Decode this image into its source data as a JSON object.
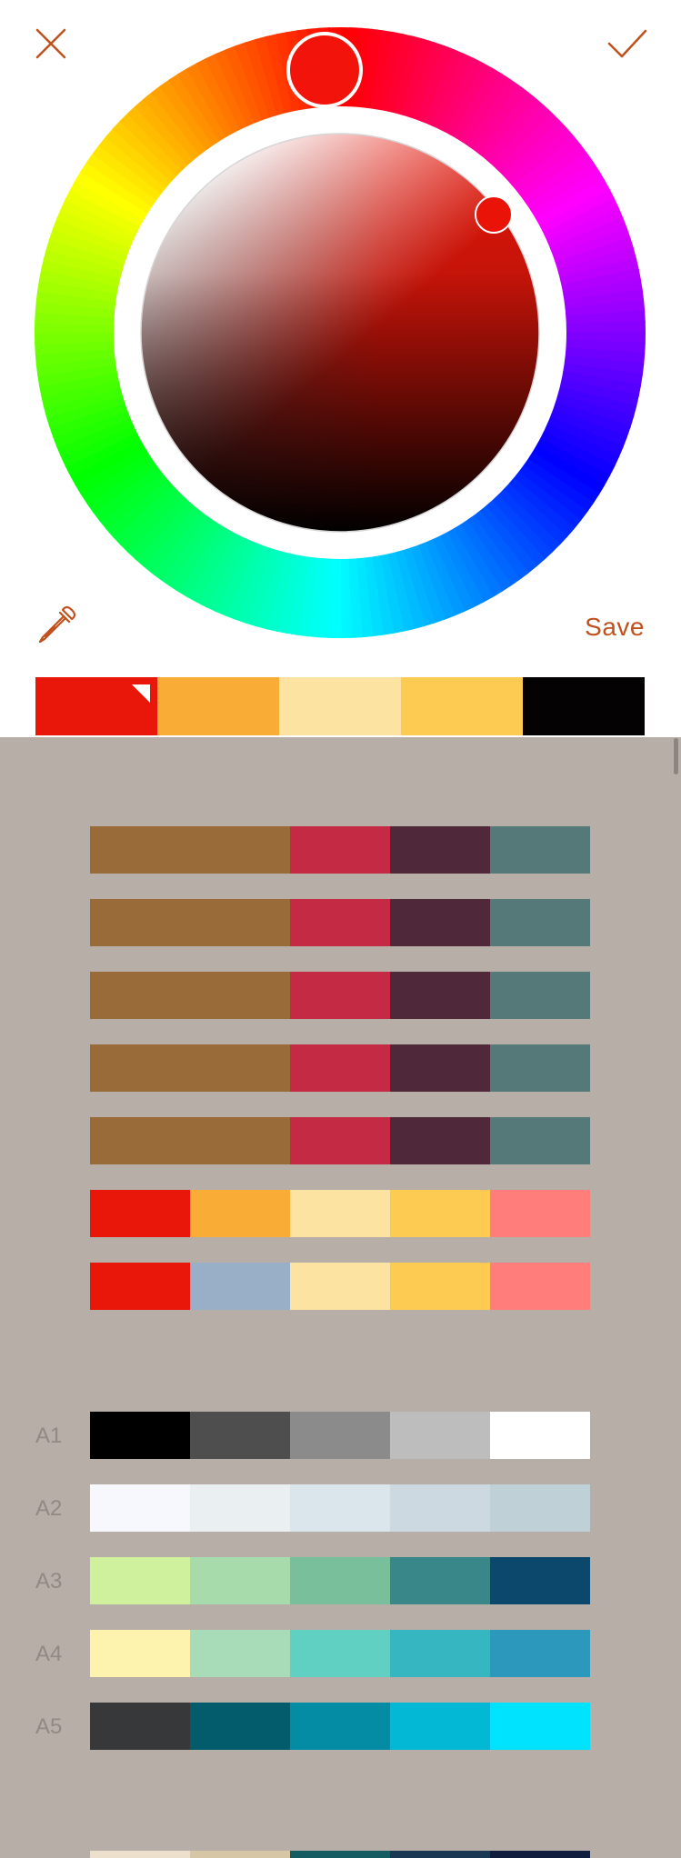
{
  "header": {
    "close_icon": "close-icon",
    "confirm_icon": "checkmark-icon",
    "accent": "#c0511d"
  },
  "picker": {
    "eyedropper_icon": "eyedropper-icon",
    "save_label": "Save",
    "selected_color": "#e8170a"
  },
  "current_palette": [
    "#e8170a",
    "#f9ad36",
    "#fde3a1",
    "#fecb52",
    "#050203"
  ],
  "saved_palettes": [
    [
      "#996b38",
      "#996b38",
      "#c42a44",
      "#4f283a",
      "#557879"
    ],
    [
      "#996b38",
      "#996b38",
      "#c42a44",
      "#4f283a",
      "#557879"
    ],
    [
      "#996b38",
      "#996b38",
      "#c42a44",
      "#4f283a",
      "#557879"
    ],
    [
      "#996b38",
      "#996b38",
      "#c42a44",
      "#4f283a",
      "#557879"
    ],
    [
      "#996b38",
      "#996b38",
      "#c42a44",
      "#4f283a",
      "#557879"
    ],
    [
      "#e8170a",
      "#f9ad36",
      "#fde3a1",
      "#fecb52",
      "#ff7e7c"
    ],
    [
      "#e8170a",
      "#99afc8",
      "#fde3a1",
      "#fecb52",
      "#ff7e7c"
    ]
  ],
  "preset_palettes": [
    {
      "label": "A1",
      "colors": [
        "#000000",
        "#4e4e4e",
        "#8b8b8b",
        "#bdbdbd",
        "#ffffff"
      ]
    },
    {
      "label": "A2",
      "colors": [
        "#f6f8fd",
        "#eaf0f1",
        "#dbe6ec",
        "#ccd9e0",
        "#bfd0d7"
      ]
    },
    {
      "label": "A3",
      "colors": [
        "#cff09c",
        "#a7dbab",
        "#79bf9c",
        "#3a8789",
        "#0b486b"
      ]
    },
    {
      "label": "A4",
      "colors": [
        "#fdf3ae",
        "#a8dcb9",
        "#5fd0c1",
        "#36b6c1",
        "#2c99bc"
      ]
    },
    {
      "label": "A5",
      "colors": [
        "#363839",
        "#025c6c",
        "#048ca4",
        "#02b8d5",
        "#00e3ff"
      ]
    }
  ],
  "partial_palette": [
    "#ece0cc",
    "#d7c6a5",
    "#145c61",
    "#1a3753",
    "#111d3c"
  ]
}
